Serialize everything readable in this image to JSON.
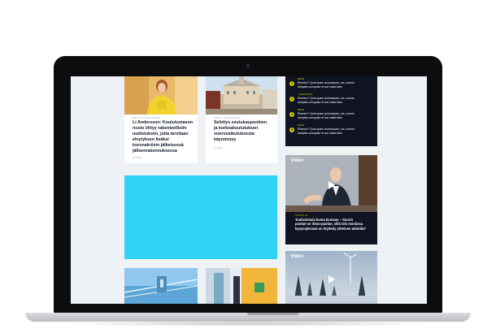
{
  "articles": [
    {
      "meta": "ERITYIS- JA OPETUSTOIMI",
      "headline": "Li Andersson: Koulutustason\nnosto liittyy rakenteellisiin\nuudistuksiin, joita tarvitaan\nelvytyksen lisäksi\nkoronakriisin jälkeisessä\njälleenrakennuksessa",
      "date": "12.4.2020"
    },
    {
      "meta": "ERITYIS- JA OPETUSTOIMI",
      "headline": "Selvitys seutukaupunkien\nja korkeakoulutuksen\nvuorovaikutuksesta\nkäynnistyy",
      "date": "12.4.2020"
    }
  ],
  "toplist": [
    {
      "num": "2",
      "category": "MEDIA",
      "text": "Ehentur? Quid quam acimoluptur, ius, volorio\ndoluptia cumquiae et aut ullaut labo"
    },
    {
      "num": "3",
      "category": "YHTEISKUNTA",
      "text": "Ehentur? Quid quam acimoluptur, ius, volorio\ndoluptia cumquiae et aut ullaut labo"
    },
    {
      "num": "4",
      "category": "MEDIA",
      "text": "Ehentur? Quid quam acimoluptur, ius, volorio\ndoluptia cumquiae et aut ullaut labo"
    },
    {
      "num": "5",
      "category": "MEDIA",
      "text": "Ehentur? Quid quam acimoluptur, ius, volorio\ndoluptia cumquiae et aut ullaut labo"
    }
  ],
  "videos": [
    {
      "label": "Video",
      "category": "TALOUS · AL",
      "title": "Tuulivoimala kunta kuntaan – Suurin\npuolue on Simo-puolue, sillä niin moniissa\nkysymyksissä on löydetty yhteinen tahtotila\""
    },
    {
      "label": "Video"
    }
  ],
  "colors": {
    "accent": "#d4d000",
    "dark_panel": "#0f1322",
    "ad_block": "#2fd3f5",
    "page_bg": "#eef2f4"
  },
  "icons": [
    "camera-dot",
    "play-icon"
  ]
}
